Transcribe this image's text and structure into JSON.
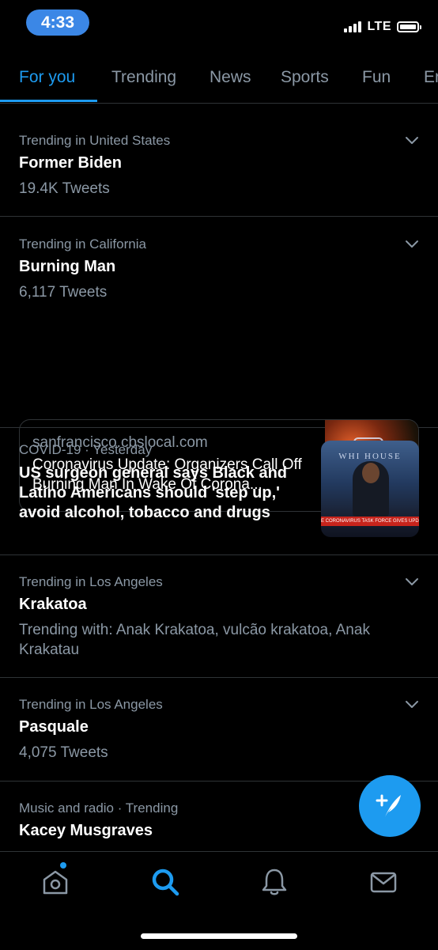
{
  "status_bar": {
    "time": "4:33",
    "network": "LTE"
  },
  "tabs": [
    {
      "label": "For you",
      "active": true
    },
    {
      "label": "Trending",
      "active": false
    },
    {
      "label": "News",
      "active": false
    },
    {
      "label": "Sports",
      "active": false
    },
    {
      "label": "Fun",
      "active": false
    },
    {
      "label": "Er",
      "active": false
    }
  ],
  "feed": {
    "items": [
      {
        "context": "Trending in United States",
        "title": "Former Biden",
        "count": "19.4K Tweets"
      },
      {
        "context": "Trending in California",
        "title": "Burning Man",
        "count": "6,117 Tweets",
        "card": {
          "domain": "sanfrancisco.cbslocal.com",
          "title": "Coronavirus Update: Organizers Call Off Burning Man In Wake Of Corona..."
        }
      },
      {
        "context": "COVID-19 · Yesterday",
        "title": "US surgeon general says Black and Latino Americans should 'step up,' avoid alcohol, tobacco and drugs",
        "image": {
          "wh": "WHI HOUSE",
          "ticker": "E CORONAVIRUS TASK FORCE GIVES UPDA"
        }
      },
      {
        "context": "Trending in Los Angeles",
        "title": "Krakatoa",
        "count": "Trending with: Anak Krakatoa, vulcão krakatoa, Anak Krakatau"
      },
      {
        "context": "Trending in Los Angeles",
        "title": "Pasquale",
        "count": "4,075 Tweets"
      },
      {
        "context": "Music and radio · Trending",
        "title": "Kacey Musgraves"
      }
    ]
  },
  "icons": {
    "fab": "compose-tweet-icon",
    "nav": [
      "home-icon",
      "search-icon",
      "notifications-bell-icon",
      "messages-envelope-icon"
    ]
  },
  "colors": {
    "accent": "#1d9bf0",
    "background": "#000000",
    "secondary_text": "#8b98a5",
    "divider": "#2f3336",
    "time_pill": "#3b87e6"
  }
}
